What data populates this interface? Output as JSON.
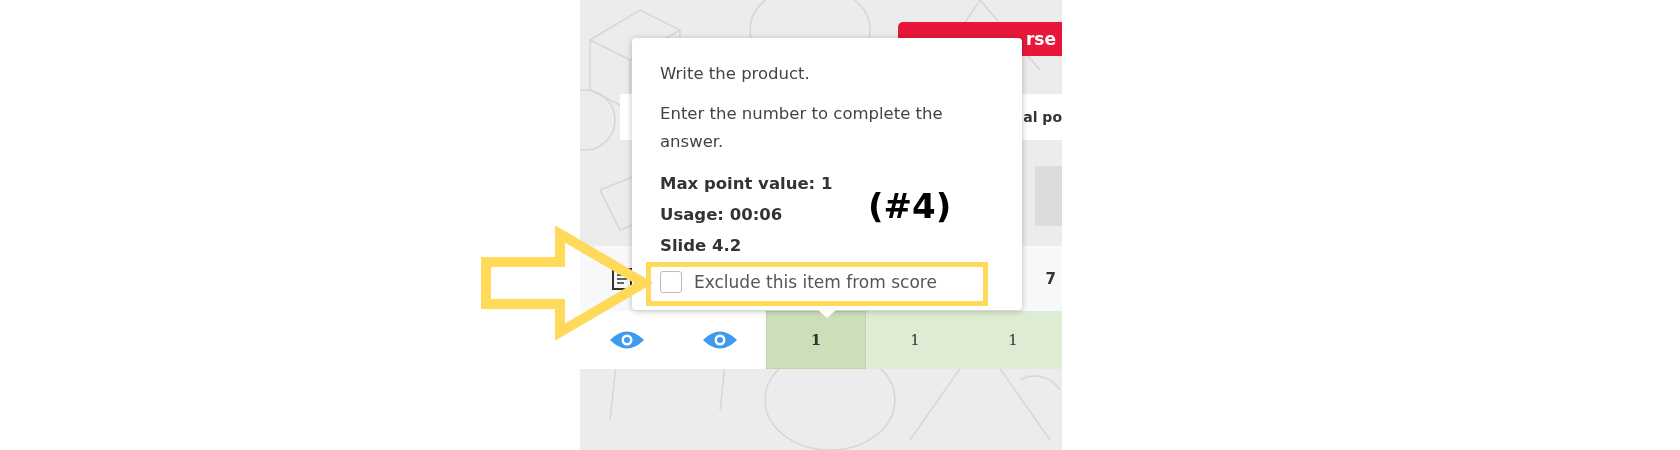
{
  "course_button": {
    "label": "rse"
  },
  "header_bar": {
    "text": "al po"
  },
  "table": {
    "header_value": "7",
    "cells": [
      {
        "value": "1",
        "selected": true
      },
      {
        "value": "1",
        "selected": false
      },
      {
        "value": "1",
        "selected": false
      }
    ]
  },
  "popover": {
    "lines": [
      "Write the product.",
      "Enter the number to complete the answer."
    ],
    "facts": [
      "Max point value: 1",
      "Usage: 00:06",
      "Slide 4.2"
    ],
    "exclude": {
      "label": "Exclude this item from score",
      "checked": false
    }
  },
  "annotation": {
    "label": "(#4)"
  }
}
